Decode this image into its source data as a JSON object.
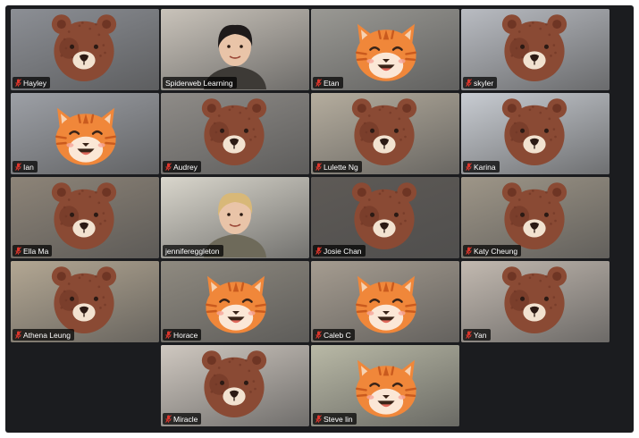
{
  "colors": {
    "background": "#1b1c1f",
    "active_speaker": "#2fb14c",
    "muted_icon": "#e0362c",
    "bear": "#8a4a34",
    "bear_dark": "#6e3524",
    "tiger": "#f0873a",
    "tiger_stripe": "#c95a1e"
  },
  "participants": [
    {
      "name": "Hayley",
      "mask": "bear",
      "muted": true,
      "bg": "#8c8f95"
    },
    {
      "name": "Spiderweb Learning",
      "mask": "none",
      "muted": false,
      "active": true,
      "bg": "#c9c3ba"
    },
    {
      "name": "Etan",
      "mask": "tiger",
      "muted": true,
      "bg": "#9a9994"
    },
    {
      "name": "skyler",
      "mask": "bear",
      "muted": true,
      "bg": "#b9bcc2"
    },
    {
      "name": "Ian",
      "mask": "tiger",
      "muted": true,
      "bg": "#9da0a6"
    },
    {
      "name": "Audrey",
      "mask": "bear",
      "muted": true,
      "bg": "#8f8c88"
    },
    {
      "name": "Lulette Ng",
      "mask": "bear",
      "muted": true,
      "bg": "#b5ad9e"
    },
    {
      "name": "Karina",
      "mask": "bear",
      "muted": true,
      "bg": "#c8ccd2"
    },
    {
      "name": "Ella Ma",
      "mask": "bear",
      "muted": true,
      "bg": "#8d8478"
    },
    {
      "name": "jennifereggleton",
      "mask": "none",
      "muted": false,
      "bg": "#d9d6cc"
    },
    {
      "name": "Josie Chan",
      "mask": "bear",
      "muted": true,
      "bg": "#5e5a56"
    },
    {
      "name": "Katy Cheung",
      "mask": "bear",
      "muted": true,
      "bg": "#9e9688"
    },
    {
      "name": "Athena Leung",
      "mask": "bear",
      "muted": true,
      "bg": "#b3a793"
    },
    {
      "name": "Horace",
      "mask": "tiger",
      "muted": true,
      "bg": "#8f8a80"
    },
    {
      "name": "Caleb C",
      "mask": "tiger",
      "muted": true,
      "bg": "#a59c90"
    },
    {
      "name": "Yan",
      "mask": "bear",
      "muted": true,
      "bg": "#c2b9b0"
    },
    {
      "name": "Miracle",
      "mask": "bear",
      "muted": true,
      "bg": "#cfc8c0"
    },
    {
      "name": "Steve lin",
      "mask": "tiger",
      "muted": true,
      "bg": "#b9b9a6"
    }
  ]
}
